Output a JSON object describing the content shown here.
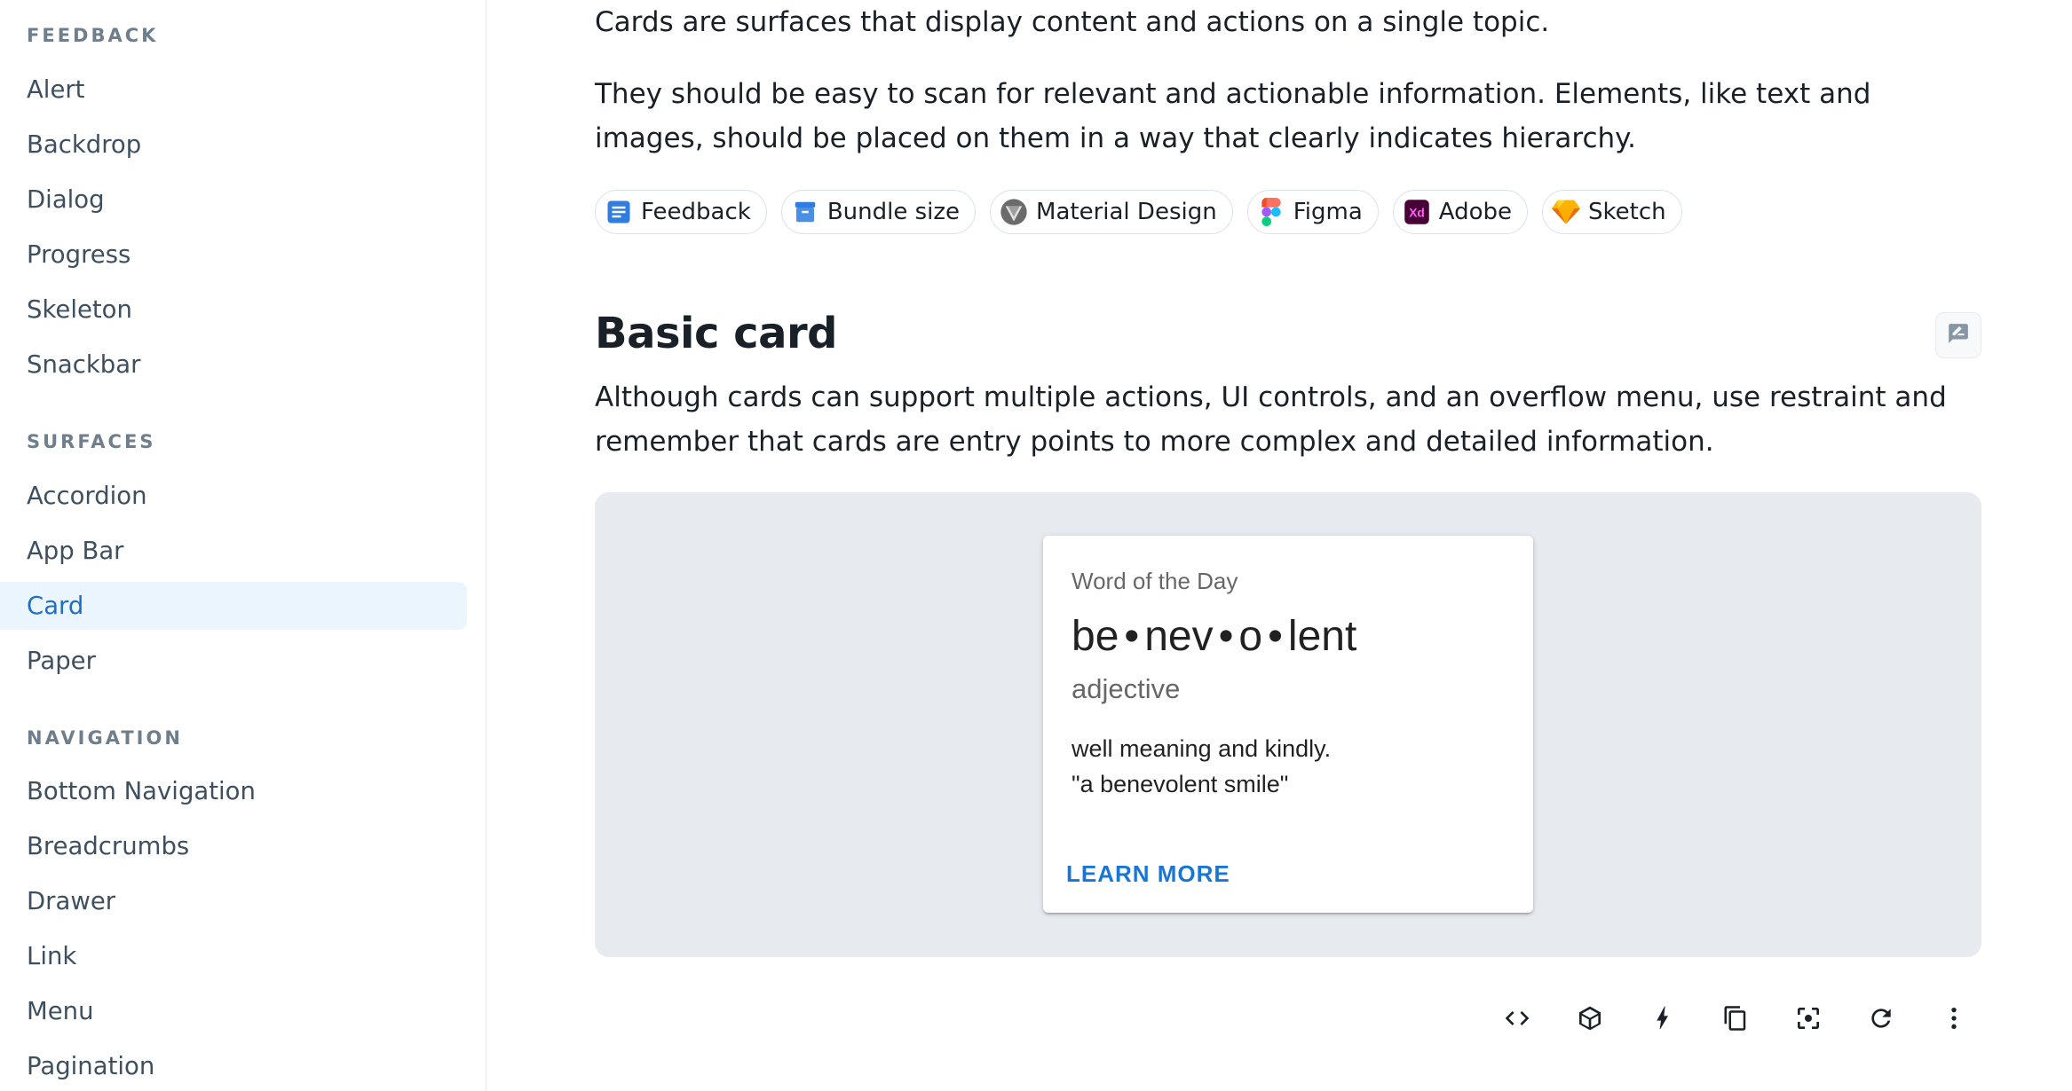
{
  "sidebar": {
    "sections": [
      {
        "heading": "FEEDBACK",
        "items": [
          "Alert",
          "Backdrop",
          "Dialog",
          "Progress",
          "Skeleton",
          "Snackbar"
        ]
      },
      {
        "heading": "SURFACES",
        "items": [
          "Accordion",
          "App Bar",
          "Card",
          "Paper"
        ]
      },
      {
        "heading": "NAVIGATION",
        "items": [
          "Bottom Navigation",
          "Breadcrumbs",
          "Drawer",
          "Link",
          "Menu",
          "Pagination"
        ]
      }
    ],
    "active_item": "Card"
  },
  "main": {
    "intro_1": "Cards are surfaces that display content and actions on a single topic.",
    "intro_2": "They should be easy to scan for relevant and actionable information. Elements, like text and images, should be placed on them in a way that clearly indicates hierarchy.",
    "chips": [
      {
        "label": "Feedback",
        "icon": "feedback-icon"
      },
      {
        "label": "Bundle size",
        "icon": "bundle-size-icon"
      },
      {
        "label": "Material Design",
        "icon": "material-design-icon"
      },
      {
        "label": "Figma",
        "icon": "figma-icon"
      },
      {
        "label": "Adobe",
        "icon": "adobe-xd-icon"
      },
      {
        "label": "Sketch",
        "icon": "sketch-icon"
      }
    ],
    "section_title": "Basic card",
    "section_desc": "Although cards can support multiple actions, UI controls, and an overflow menu, use restraint and remember that cards are entry points to more complex and detailed information.",
    "card": {
      "overline": "Word of the Day",
      "word_parts": [
        "be",
        "nev",
        "o",
        "lent"
      ],
      "word_separator": "•",
      "part_of_speech": "adjective",
      "definition": "well meaning and kindly.",
      "example": "\"a benevolent smile\"",
      "action": "LEARN MORE"
    },
    "toolbar_icons": [
      "code-icon",
      "codesandbox-icon",
      "stackblitz-icon",
      "copy-icon",
      "reset-focus-icon",
      "reset-demo-icon",
      "more-options-icon"
    ]
  },
  "colors": {
    "accent": "#1976d2",
    "active_bg": "#ebf5fe",
    "active_text": "#1f6fc4",
    "demo_bg": "#e7ebf0"
  }
}
